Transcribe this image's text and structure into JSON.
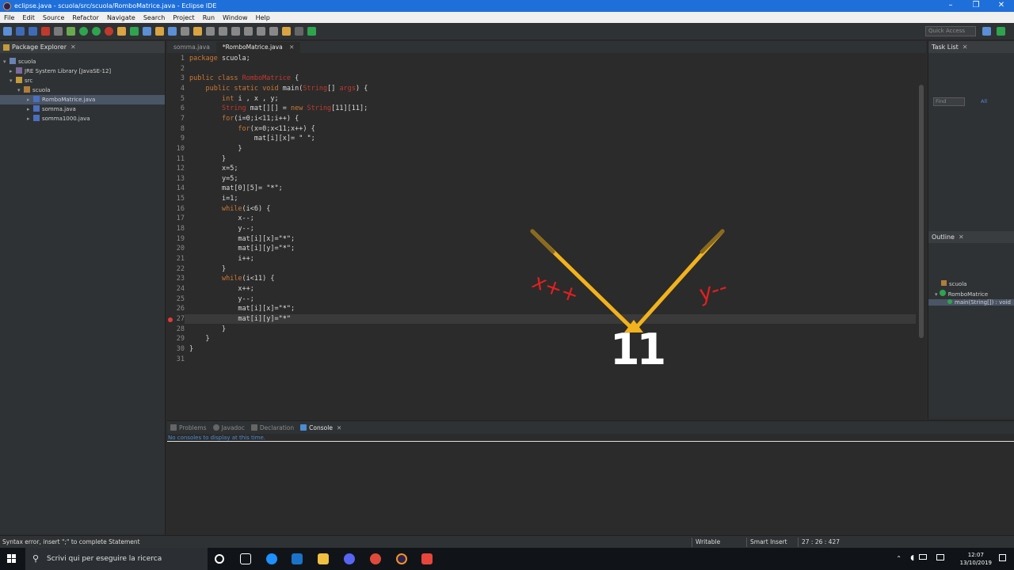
{
  "window": {
    "title": "eclipse.java - scuola/src/scuola/RomboMatrice.java - Eclipse IDE",
    "controls": [
      "–",
      "❐",
      "✕"
    ]
  },
  "menu": [
    "File",
    "Edit",
    "Source",
    "Refactor",
    "Navigate",
    "Search",
    "Project",
    "Run",
    "Window",
    "Help"
  ],
  "toolbar": {
    "quick_access": "Quick Access"
  },
  "package_explorer": {
    "title": "Package Explorer",
    "tree": [
      {
        "label": "scuola",
        "indent": 0
      },
      {
        "label": "JRE System Library [JavaSE-12]",
        "indent": 1
      },
      {
        "label": "src",
        "indent": 1
      },
      {
        "label": "scuola",
        "indent": 2
      },
      {
        "label": "RomboMatrice.java",
        "indent": 3,
        "selected": true
      },
      {
        "label": "somma.java",
        "indent": 3
      },
      {
        "label": "somma1000.java",
        "indent": 3
      }
    ]
  },
  "editor": {
    "tabs": [
      {
        "label": "somma.java",
        "active": false
      },
      {
        "label": "*RomboMatrice.java",
        "active": true
      }
    ],
    "current_line": 27,
    "error_line": 27,
    "lines": [
      "package scuola;",
      "",
      "public class RomboMatrice {",
      "    public static void main(String[] args) {",
      "        int i , x , y;",
      "        String mat[][] = new String[11][11];",
      "        for(i=0;i<11;i++) {",
      "            for(x=0;x<11;x++) {",
      "                mat[i][x]= \" \";",
      "            }",
      "        }",
      "        x=5;",
      "        y=5;",
      "        mat[0][5]= \"*\";",
      "        i=1;",
      "        while(i<6) {",
      "            x--;",
      "            y--;",
      "            mat[i][x]=\"*\";",
      "            mat[i][y]=\"*\";",
      "            i++;",
      "        }",
      "        while(i<11) {",
      "            x++;",
      "            y--;",
      "            mat[i][x]=\"*\";",
      "            mat[i][y]=\"*\"",
      "        }",
      "    }",
      "}",
      ""
    ]
  },
  "task_list": {
    "title": "Task List",
    "find_placeholder": "Find",
    "all_label": "All"
  },
  "outline": {
    "title": "Outline",
    "items": [
      {
        "label": "scuola"
      },
      {
        "label": "RomboMatrice"
      },
      {
        "label": "main(String[]) : void"
      }
    ]
  },
  "console": {
    "tabs": [
      "Problems",
      "Javadoc",
      "Declaration",
      "Console"
    ],
    "active_tab": "Console",
    "message": "No consoles to display at this time."
  },
  "status": {
    "message": "Syntax error, insert \";\" to complete Statement",
    "writable": "Writable",
    "insert_mode": "Smart Insert",
    "position": "27 : 26 : 427"
  },
  "taskbar": {
    "search_placeholder": "Scrivi qui per eseguire la ricerca",
    "time": "12:07",
    "date": "13/10/2019"
  },
  "annotation": {
    "left_label": "x++",
    "right_label": "y--",
    "number": "11",
    "colors": {
      "arrows": "#f2b21d",
      "handwriting": "#e02020"
    }
  }
}
